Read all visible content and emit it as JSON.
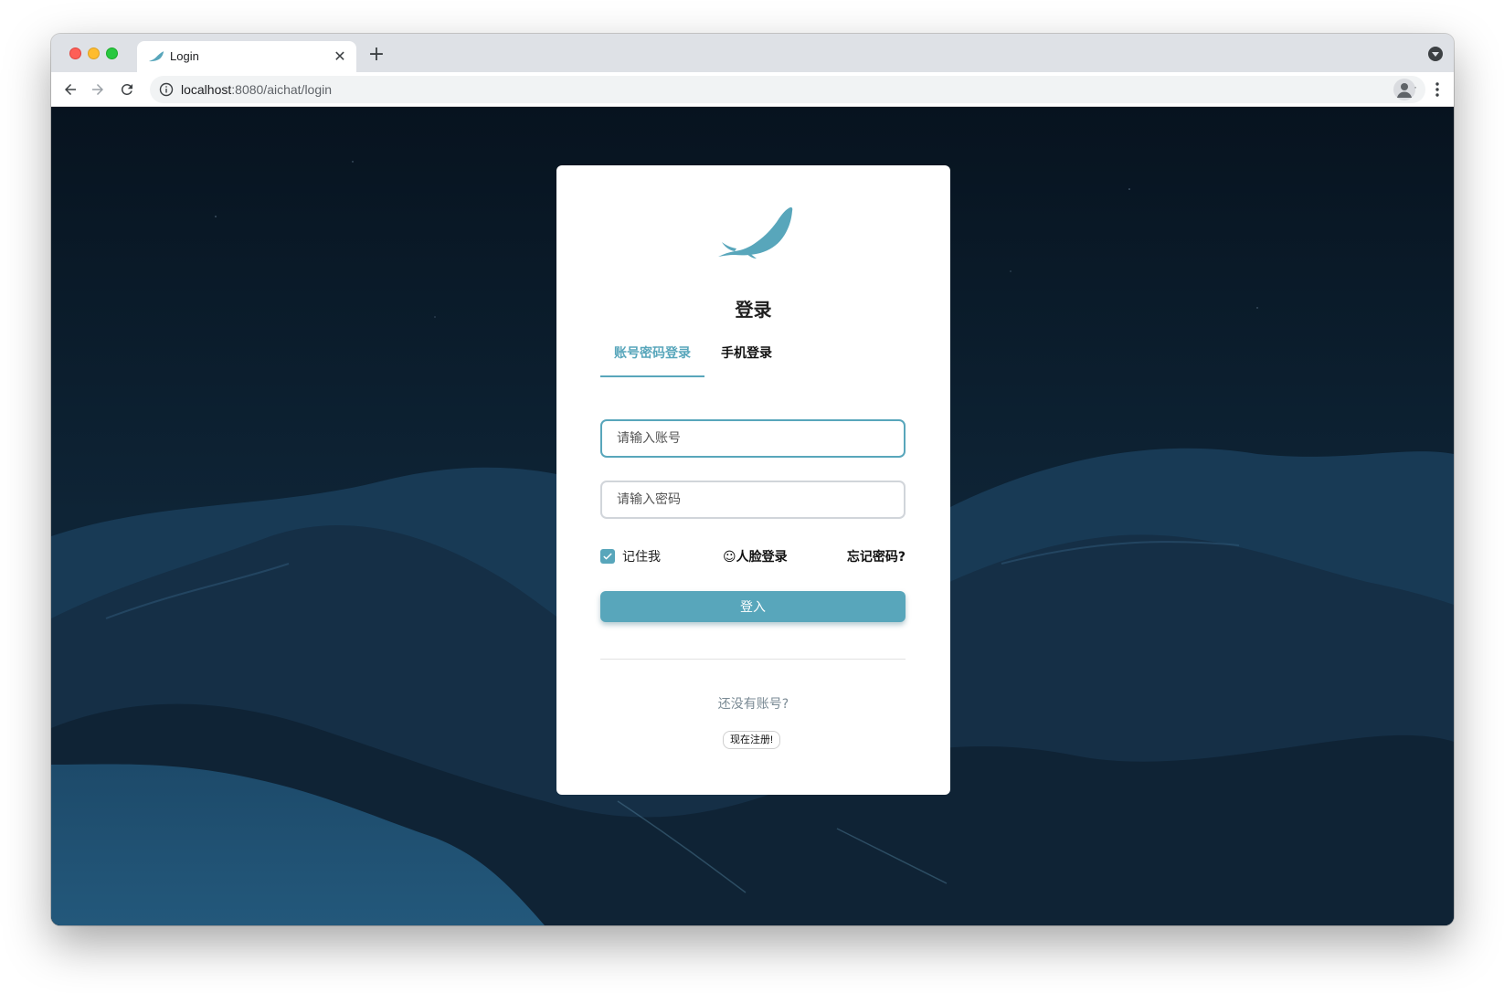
{
  "browser": {
    "tab_title": "Login",
    "new_tab_label": "+",
    "close_label": "✕",
    "url_host": "localhost",
    "url_rest": ":8080/aichat/login"
  },
  "login": {
    "title": "登录",
    "tabs": [
      {
        "label": "账号密码登录",
        "active": true
      },
      {
        "label": "手机登录",
        "active": false
      }
    ],
    "username_placeholder": "请输入账号",
    "password_placeholder": "请输入密码",
    "remember_label": "记住我",
    "remember_checked": true,
    "face_login_label": "☺人脸登录",
    "forgot_label": "忘记密码?",
    "submit_label": "登入",
    "no_account_text": "还没有账号?",
    "register_label": "现在注册!"
  },
  "colors": {
    "accent": "#58a6bb",
    "background_night": "#0d2236"
  },
  "icons": {
    "logo": "whale-logo-icon",
    "favicon": "whale-favicon-icon"
  }
}
